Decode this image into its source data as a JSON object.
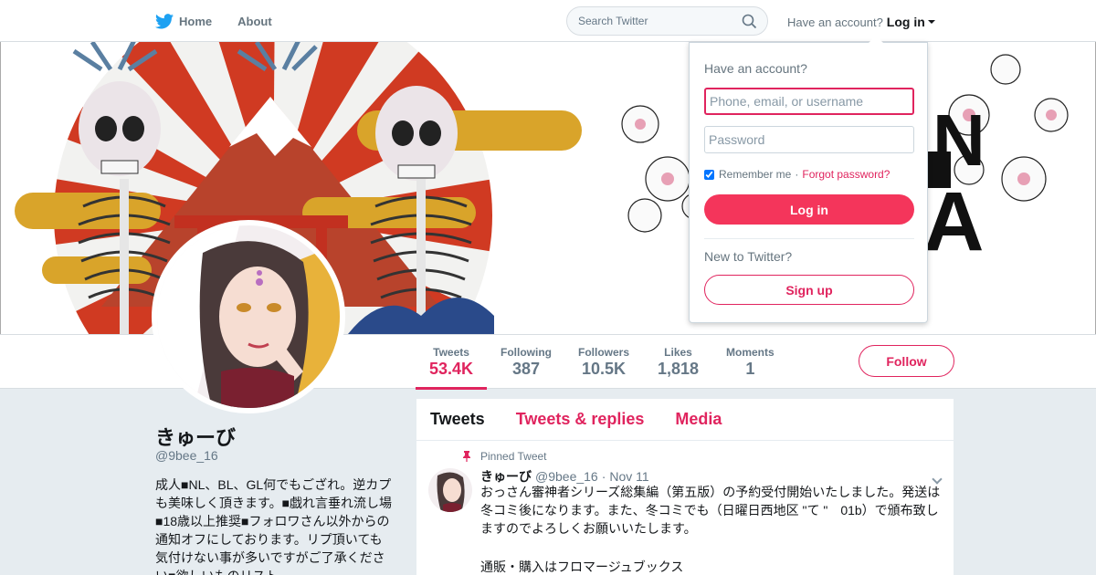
{
  "nav": {
    "home_label": "Home",
    "about_label": "About",
    "search_placeholder": "Search Twitter",
    "have_account": "Have an account?",
    "login_label": "Log in"
  },
  "login_dropdown": {
    "title": "Have an account?",
    "username_placeholder": "Phone, email, or username",
    "password_placeholder": "Password",
    "remember_label": "Remember me",
    "separator": "·",
    "forgot_label": "Forgot password?",
    "login_button": "Log in",
    "new_label": "New to Twitter?",
    "signup_button": "Sign up"
  },
  "stats": [
    {
      "label": "Tweets",
      "value": "53.4K"
    },
    {
      "label": "Following",
      "value": "387"
    },
    {
      "label": "Followers",
      "value": "10.5K"
    },
    {
      "label": "Likes",
      "value": "1,818"
    },
    {
      "label": "Moments",
      "value": "1"
    }
  ],
  "follow_button": "Follow",
  "profile": {
    "name": "きゅーび",
    "handle": "@9bee_16",
    "bio": "成人■NL、BL、GL何でもござれ。逆カプも美味しく頂きます。■戯れ言垂れ流し場■18歳以上推奨■フォロワさん以外からの通知オフにしております。リプ頂いても気付けない事が多いですがご了承ください■欲しいものリスト"
  },
  "tabs": [
    "Tweets",
    "Tweets & replies",
    "Media"
  ],
  "tweet": {
    "pinned_label": "Pinned Tweet",
    "name": "きゅーび",
    "handle": "@9bee_16",
    "separator": "·",
    "date": "Nov 11",
    "text": "おっさん審神者シリーズ総集編（第五版）の予約受付開始いたしました。発送は冬コミ後になります。また、冬コミでも（日曜日西地区 \"て \"　01b）で頒布致しますのでよろしくお願いいたします。",
    "text2": "通販・購入はフロマージュブックス"
  },
  "colors": {
    "accent": "#e0245e",
    "login_button": "#f4355b",
    "twitter_blue": "#1da1f2"
  }
}
